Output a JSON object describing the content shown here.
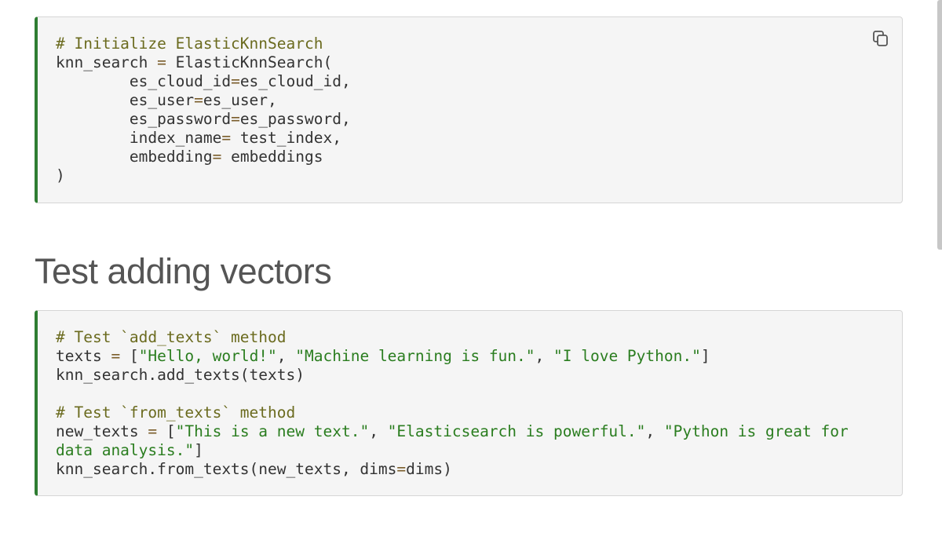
{
  "blocks": [
    {
      "lines": [
        [
          {
            "t": "# Initialize ElasticKnnSearch",
            "c": "comment"
          }
        ],
        [
          {
            "t": "knn_search "
          },
          {
            "t": "=",
            "c": "op"
          },
          {
            "t": " ElasticKnnSearch("
          }
        ],
        [
          {
            "t": "        es_cloud_id"
          },
          {
            "t": "=",
            "c": "op"
          },
          {
            "t": "es_cloud_id,"
          }
        ],
        [
          {
            "t": "        es_user"
          },
          {
            "t": "=",
            "c": "op"
          },
          {
            "t": "es_user,"
          }
        ],
        [
          {
            "t": "        es_password"
          },
          {
            "t": "=",
            "c": "op"
          },
          {
            "t": "es_password,"
          }
        ],
        [
          {
            "t": "        index_name"
          },
          {
            "t": "=",
            "c": "op"
          },
          {
            "t": " test_index,"
          }
        ],
        [
          {
            "t": "        embedding"
          },
          {
            "t": "=",
            "c": "op"
          },
          {
            "t": " embeddings"
          }
        ],
        [
          {
            "t": ")"
          }
        ]
      ]
    },
    {
      "lines": [
        [
          {
            "t": "# Test `add_texts` method",
            "c": "comment"
          }
        ],
        [
          {
            "t": "texts "
          },
          {
            "t": "=",
            "c": "op"
          },
          {
            "t": " ["
          },
          {
            "t": "\"Hello, world!\"",
            "c": "string"
          },
          {
            "t": ", "
          },
          {
            "t": "\"Machine learning is fun.\"",
            "c": "string"
          },
          {
            "t": ", "
          },
          {
            "t": "\"I love Python.\"",
            "c": "string"
          },
          {
            "t": "]"
          }
        ],
        [
          {
            "t": "knn_search.add_texts(texts)"
          }
        ],
        [
          {
            "t": ""
          }
        ],
        [
          {
            "t": "# Test `from_texts` method",
            "c": "comment"
          }
        ],
        [
          {
            "t": "new_texts "
          },
          {
            "t": "=",
            "c": "op"
          },
          {
            "t": " ["
          },
          {
            "t": "\"This is a new text.\"",
            "c": "string"
          },
          {
            "t": ", "
          },
          {
            "t": "\"Elasticsearch is powerful.\"",
            "c": "string"
          },
          {
            "t": ", "
          },
          {
            "t": "\"Python is great for",
            "c": "string"
          }
        ],
        [
          {
            "t": "data analysis.\"",
            "c": "string"
          },
          {
            "t": "]"
          }
        ],
        [
          {
            "t": "knn_search.from_texts(new_texts, dims"
          },
          {
            "t": "=",
            "c": "op"
          },
          {
            "t": "dims)"
          }
        ]
      ]
    }
  ],
  "heading": "Test adding vectors",
  "copy_icon": "copy-icon",
  "colors": {
    "accent_border": "#2e7d32",
    "comment": "#6b6b1f",
    "string": "#2a7d1f",
    "code_bg": "#f5f5f5"
  }
}
